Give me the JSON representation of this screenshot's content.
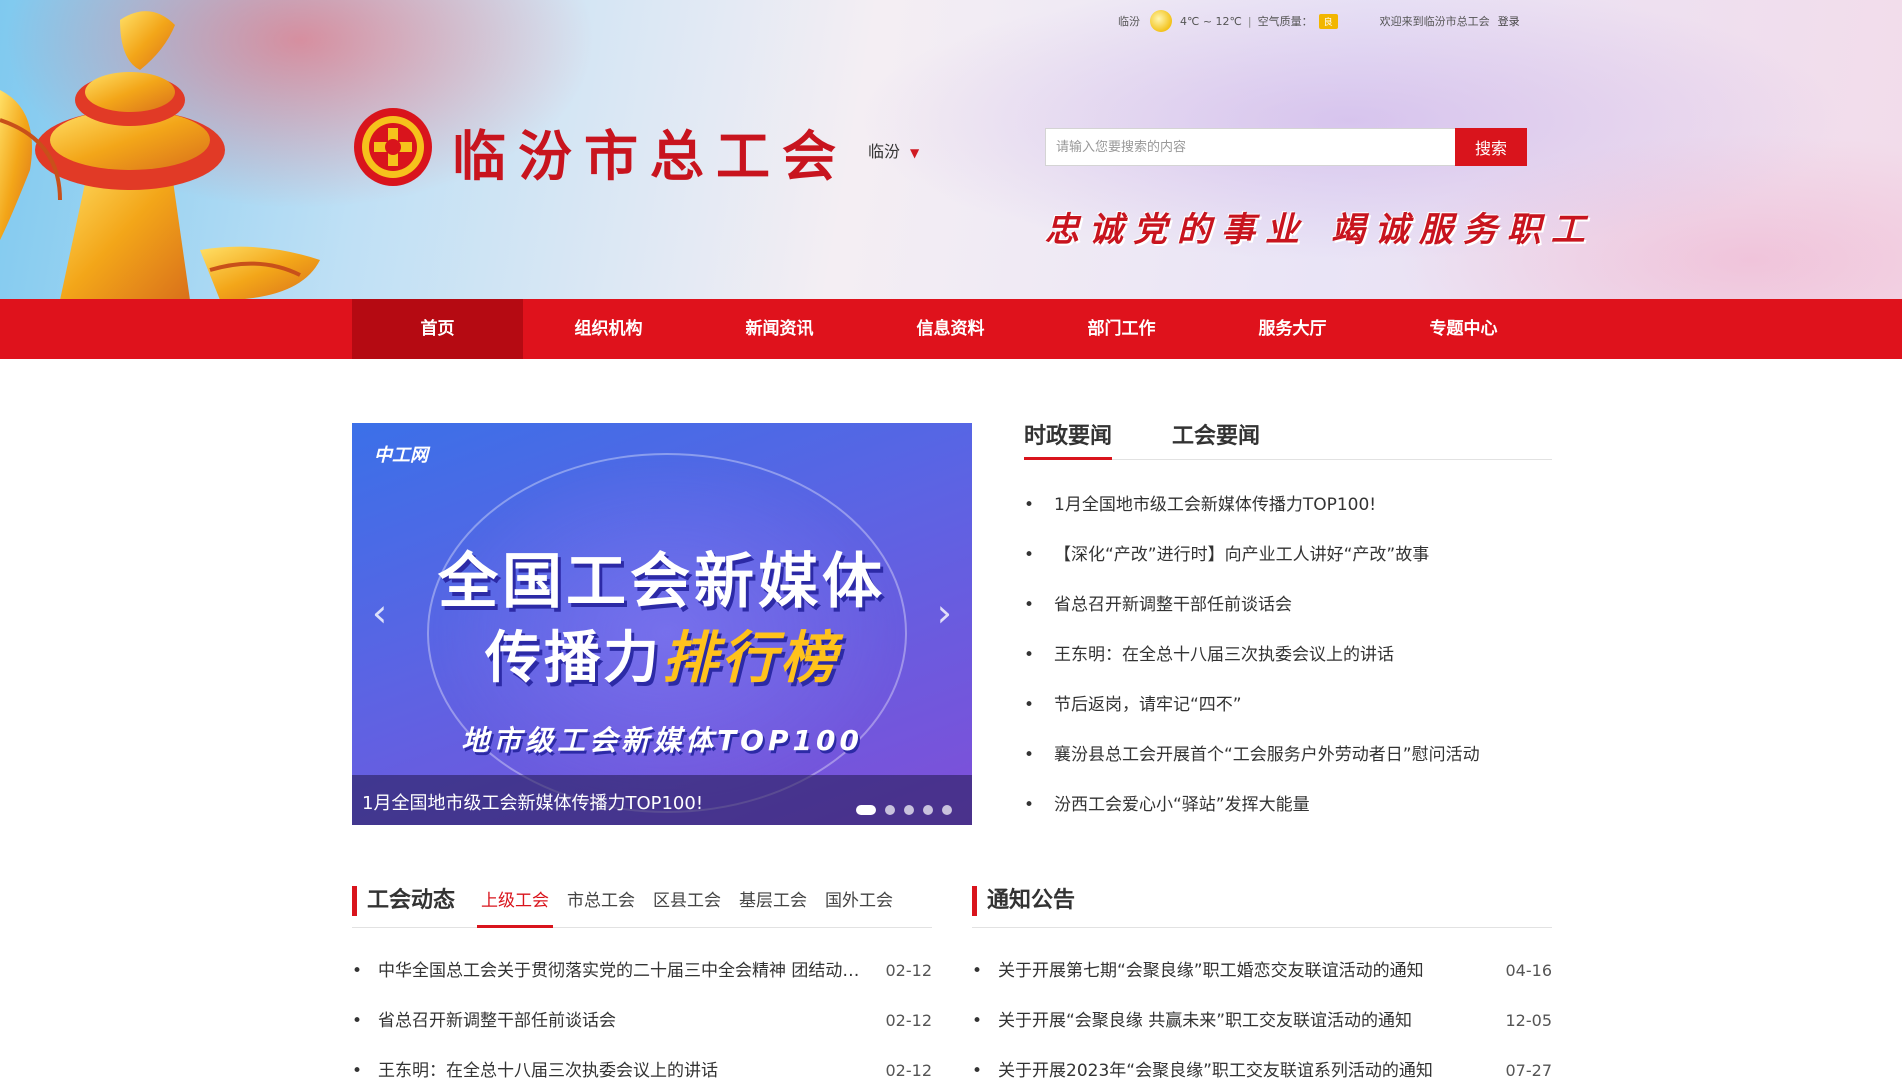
{
  "topbar": {
    "city": "临汾",
    "temperature": "4℃ ~ 12℃",
    "air_quality_label": "空气质量：",
    "air_quality_value": "良",
    "welcome": "欢迎来到临汾市总工会",
    "login": "登录"
  },
  "header": {
    "site_title": "临汾市总工会",
    "city_selector": "临汾",
    "search_placeholder": "请输入您要搜索的内容",
    "search_button": "搜索",
    "slogan": "忠诚党的事业 竭诚服务职工"
  },
  "nav": {
    "items": [
      {
        "label": "首页"
      },
      {
        "label": "组织机构"
      },
      {
        "label": "新闻资讯"
      },
      {
        "label": "信息资料"
      },
      {
        "label": "部门工作"
      },
      {
        "label": "服务大厅"
      },
      {
        "label": "专题中心"
      }
    ],
    "active": 0
  },
  "carousel": {
    "source_mark": "中工网",
    "headline_1": "全国工会新媒体",
    "headline_2a": "传播力",
    "headline_2b": "排行榜",
    "headline_3": "地市级工会新媒体TOP100",
    "caption": "1月全国地市级工会新媒体传播力TOP100!",
    "slide_count": 5,
    "active_slide": 0
  },
  "news": {
    "tabs": [
      {
        "label": "时政要闻"
      },
      {
        "label": "工会要闻"
      }
    ],
    "active_tab": 0,
    "items": [
      "1月全国地市级工会新媒体传播力TOP100!",
      "【深化“产改”进行时】向产业工人讲好“产改”故事",
      "省总召开新调整干部任前谈话会",
      "王东明：在全总十八届三次执委会议上的讲话",
      "节后返岗，请牢记“四不”",
      "襄汾县总工会开展首个“工会服务户外劳动者日”慰问活动",
      "汾西工会爱心小“驿站”发挥大能量"
    ]
  },
  "union_dynamics": {
    "title": "工会动态",
    "tabs": [
      "上级工会",
      "市总工会",
      "区县工会",
      "基层工会",
      "国外工会"
    ],
    "active_tab": 0,
    "items": [
      {
        "title": "中华全国总工会关于贯彻落实党的二十届三中全会精神 团结动员亿万职工",
        "date": "02-12"
      },
      {
        "title": "省总召开新调整干部任前谈话会",
        "date": "02-12"
      },
      {
        "title": "王东明：在全总十八届三次执委会议上的讲话",
        "date": "02-12"
      }
    ]
  },
  "notices": {
    "title": "通知公告",
    "items": [
      {
        "title": "关于开展第七期“会聚良缘”职工婚恋交友联谊活动的通知",
        "date": "04-16"
      },
      {
        "title": "关于开展“会聚良缘 共赢未来”职工交友联谊活动的通知",
        "date": "12-05"
      },
      {
        "title": "关于开展2023年“会聚良缘”职工交友联谊系列活动的通知",
        "date": "07-27"
      }
    ]
  },
  "colors": {
    "brand_red": "#df121c",
    "nav_active": "#b50a12",
    "title_red": "#c8141e"
  }
}
